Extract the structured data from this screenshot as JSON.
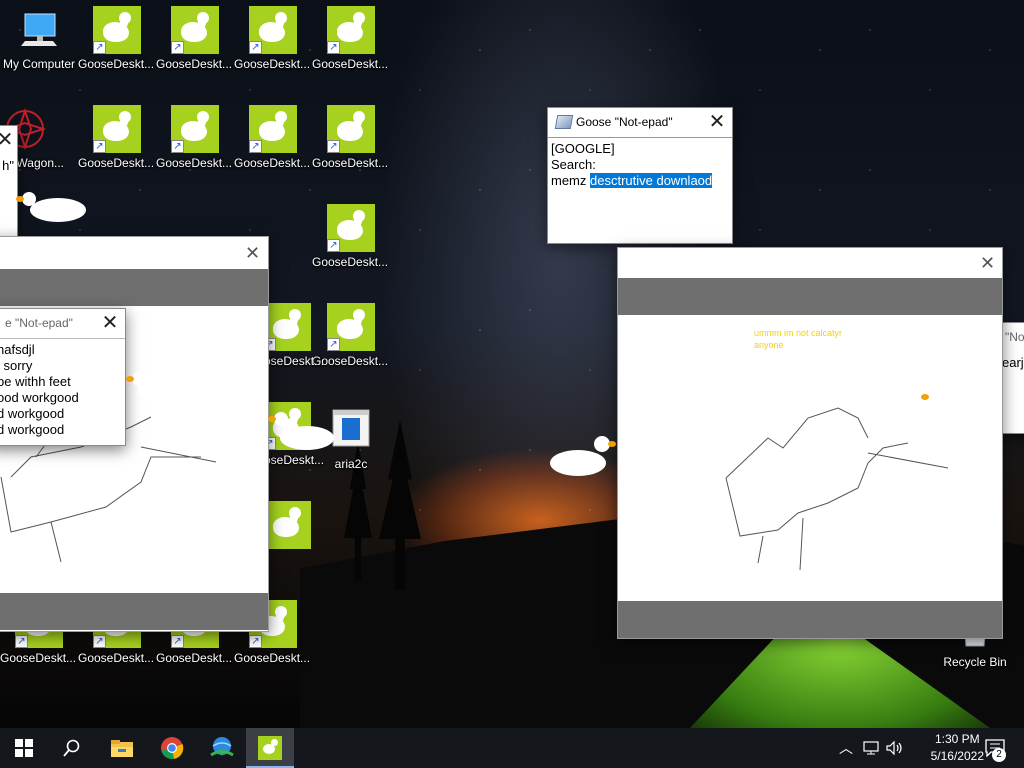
{
  "desktop": {
    "icons": [
      {
        "label": "My Computer",
        "type": "computer"
      },
      {
        "label": "GooseDeskt... - Shortcut -...",
        "type": "goose"
      },
      {
        "label": "GooseDeskt... - Shortcut -...",
        "type": "goose"
      },
      {
        "label": "GooseDeskt... - Shortcut -...",
        "type": "goose"
      },
      {
        "label": "GooseDeskt... - Shortcut -...",
        "type": "goose"
      },
      {
        "label": "taWagon...",
        "type": "app"
      },
      {
        "label": "GooseDeskt... - Shortcut -...",
        "type": "goose"
      },
      {
        "label": "GooseDeskt... - Shortcut -...",
        "type": "goose"
      },
      {
        "label": "GooseDeskt... - Shortcut -...",
        "type": "goose"
      },
      {
        "label": "GooseDeskt... - Shortcut -...",
        "type": "goose"
      },
      {
        "label": "GooseDeskt... - Shortcut -...",
        "type": "goose"
      },
      {
        "label": "GooseDeskt... - Shortcut -...",
        "type": "goose"
      },
      {
        "label": "GooseDeskt... - Shortcut -...",
        "type": "goose"
      },
      {
        "label": "GooseDeskt... rtcut -...",
        "type": "goose"
      },
      {
        "label": "aria2c",
        "type": "app"
      },
      {
        "label": "GooseDeskt... - Shortcut -...",
        "type": "goose"
      },
      {
        "label": "GooseDeskt... - Shortcut -...",
        "type": "goose"
      },
      {
        "label": "GooseDeskt... - Shortcut -...",
        "type": "goose"
      },
      {
        "label": "GooseDeskt... - Shortcut -...",
        "type": "goose"
      },
      {
        "label": "Recycle Bin",
        "type": "recycle"
      }
    ]
  },
  "notepad_main": {
    "title": "Goose \"Not-epad\"",
    "lines": [
      "[GOOGLE]",
      "Search:"
    ],
    "query_prefix": "memz ",
    "query_selected": "desctrutive downlaod"
  },
  "notepad_left": {
    "title": "e \"Not-epad\"",
    "lines": [
      "hafsdjl",
      "i sorry",
      "be withh feet",
      "ood workgood",
      "d workgood",
      "d workgood"
    ]
  },
  "notepad_partial_right": {
    "title": "\"Not",
    "line": "earjg"
  },
  "notepad_partial_left": {
    "line": "h\""
  },
  "paint_right": {
    "caption_line1": "ummm im not calcatyr",
    "caption_line2": "anyone"
  },
  "taskbar": {
    "apps": [
      "start-icon",
      "search-icon",
      "file-explorer-icon",
      "chrome-icon",
      "internet-download-manager-icon",
      "goose-desktop-icon"
    ],
    "time": "1:30 PM",
    "date": "5/16/2022",
    "notification_count": "2"
  }
}
